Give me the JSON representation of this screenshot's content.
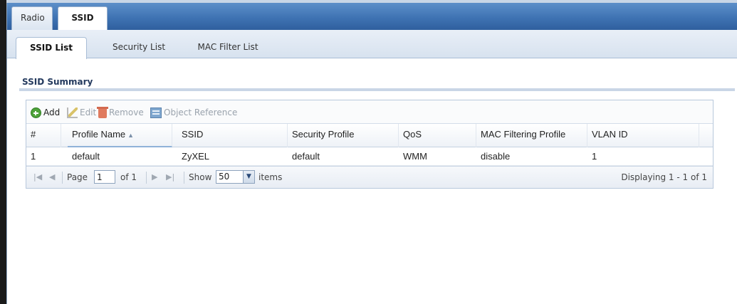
{
  "top_tabs": [
    "Radio",
    "SSID"
  ],
  "sub_tabs": [
    "SSID List",
    "Security List",
    "MAC Filter List"
  ],
  "section_title": "SSID Summary",
  "toolbar": {
    "add": "Add",
    "edit": "Edit",
    "remove": "Remove",
    "object_reference": "Object Reference"
  },
  "table": {
    "columns": [
      "#",
      "Profile Name",
      "SSID",
      "Security Profile",
      "QoS",
      "MAC Filtering Profile",
      "VLAN ID"
    ],
    "rows": [
      [
        "1",
        "default",
        "ZyXEL",
        "default",
        "WMM",
        "disable",
        "1"
      ]
    ]
  },
  "pager": {
    "page_label": "Page",
    "page_value": "1",
    "of_label": "of 1",
    "show_label": "Show",
    "show_value": "50",
    "items_label": "items",
    "displaying": "Displaying 1 - 1 of 1"
  }
}
